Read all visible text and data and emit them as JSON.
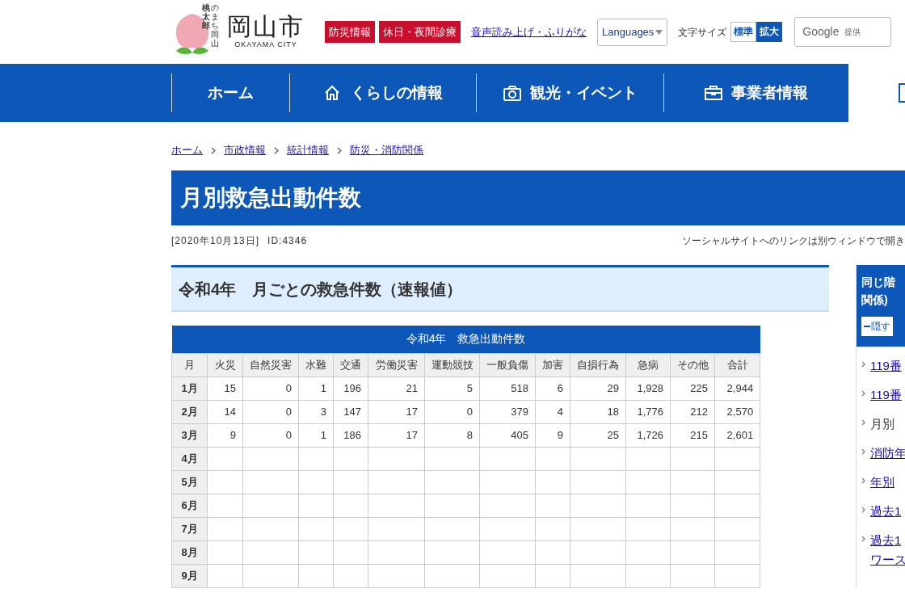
{
  "header": {
    "logo_mascot": [
      "桃太郎",
      "のまち岡山"
    ],
    "logo_title": "岡山市",
    "logo_subtitle": "OKAYAMA CITY",
    "red_links": [
      "防災情報",
      "休日・夜間診療"
    ],
    "reading_link": "音声読み上げ・ふりがな",
    "languages": "Languages",
    "font_size_label": "文字サイズ",
    "font_sizes": [
      {
        "label": "標準",
        "selected": false
      },
      {
        "label": "拡大",
        "selected": true
      }
    ],
    "search": {
      "brand": "Google",
      "note": "提供"
    }
  },
  "nav": [
    {
      "label": "ホーム",
      "kind": "none"
    },
    {
      "label": "くらしの情報",
      "kind": "house"
    },
    {
      "label": "観光・イベント",
      "kind": "camera"
    },
    {
      "label": "事業者情報",
      "kind": "briefcase"
    },
    {
      "kind": "cut"
    }
  ],
  "breadcrumb": [
    "ホーム",
    "市政情報",
    "統計情報",
    "防災・消防関係"
  ],
  "title": "月別救急出動件数",
  "date": "[2020年10月13日]",
  "id": "ID:4346",
  "social_note": "ソーシャルサイトへのリンクは別ウィンドウで開き",
  "section_heading": "令和4年　月ごとの救急件数（速報値）",
  "table": {
    "caption": "令和4年　救急出動件数",
    "columns": [
      "月",
      "火災",
      "自然災害",
      "水難",
      "交通",
      "労働災害",
      "運動競技",
      "一般負傷",
      "加害",
      "自損行為",
      "急病",
      "その他",
      "合計"
    ],
    "rows": [
      {
        "cells": [
          "1月",
          "15",
          "0",
          "1",
          "196",
          "21",
          "5",
          "518",
          "6",
          "29",
          "1,928",
          "225",
          "2,944"
        ]
      },
      {
        "cells": [
          "2月",
          "14",
          "0",
          "3",
          "147",
          "17",
          "0",
          "379",
          "4",
          "18",
          "1,776",
          "212",
          "2,570"
        ]
      },
      {
        "cells": [
          "3月",
          "9",
          "0",
          "1",
          "186",
          "17",
          "8",
          "405",
          "9",
          "25",
          "1,726",
          "215",
          "2,601"
        ]
      },
      {
        "cells": [
          "4月"
        ]
      },
      {
        "cells": [
          "5月"
        ]
      },
      {
        "cells": [
          "6月"
        ]
      },
      {
        "cells": [
          "7月"
        ]
      },
      {
        "cells": [
          "8月"
        ]
      },
      {
        "cells": [
          "9月"
        ]
      }
    ]
  },
  "sidebar": {
    "heading": [
      "同じ階",
      "関係)"
    ],
    "hide_button": "隠す",
    "items": [
      {
        "lines": [
          "119番"
        ],
        "link": true
      },
      {
        "lines": [
          "119番"
        ],
        "link": true
      },
      {
        "lines": [
          "月別"
        ],
        "link": false
      },
      {
        "lines": [
          "消防年"
        ],
        "link": true
      },
      {
        "lines": [
          "年別"
        ],
        "link": true
      },
      {
        "lines": [
          "過去1"
        ],
        "link": true
      },
      {
        "lines": [
          "過去1",
          "ワース"
        ],
        "link": true
      }
    ]
  }
}
